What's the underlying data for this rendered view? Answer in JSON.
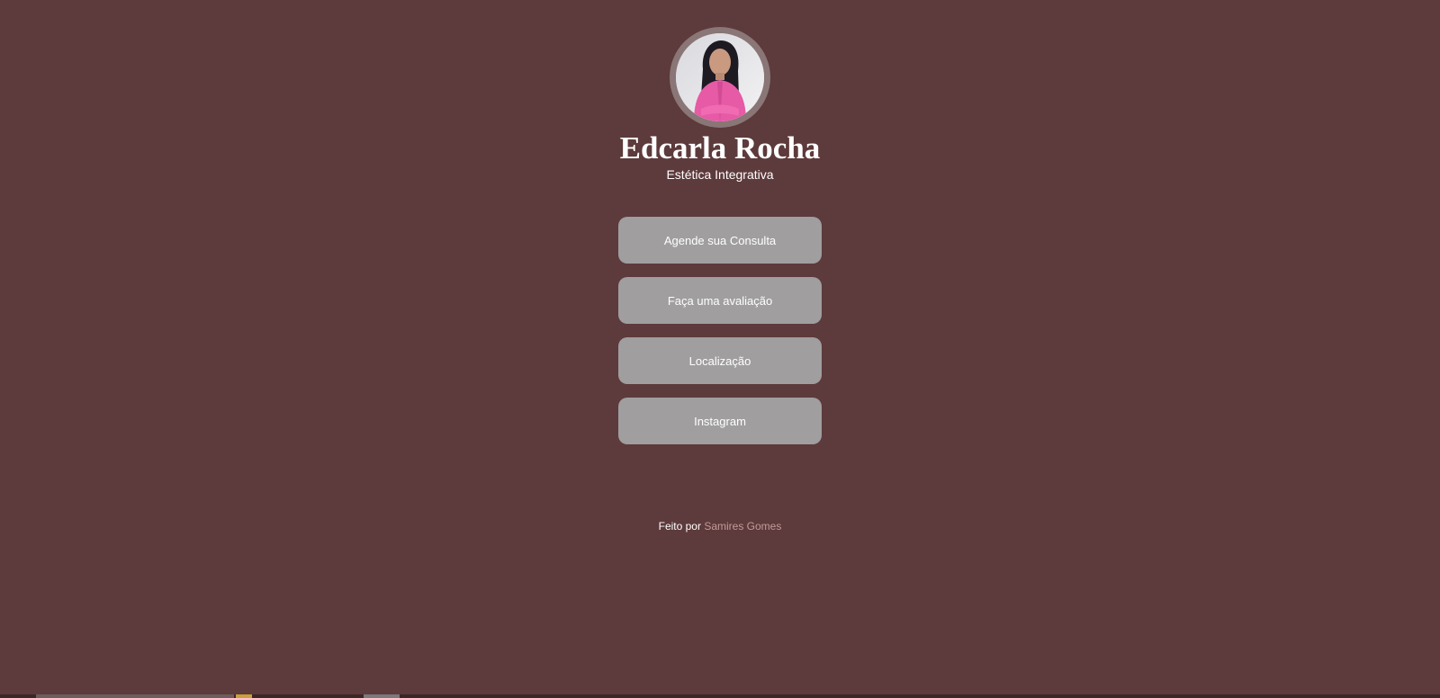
{
  "profile": {
    "name": "Edcarla Rocha",
    "subtitle": "Estética Integrativa",
    "avatar_icon": "profile-photo"
  },
  "links": [
    {
      "label": "Agende sua Consulta"
    },
    {
      "label": "Faça uma avaliação"
    },
    {
      "label": "Localização"
    },
    {
      "label": "Instagram"
    }
  ],
  "footer": {
    "prefix": "Feito por",
    "author": "Samires Gomes"
  },
  "colors": {
    "background": "#5d3a3b",
    "button": "#a09e9f",
    "link_accent": "#c49a9b",
    "avatar_ring": "#8a7677"
  }
}
